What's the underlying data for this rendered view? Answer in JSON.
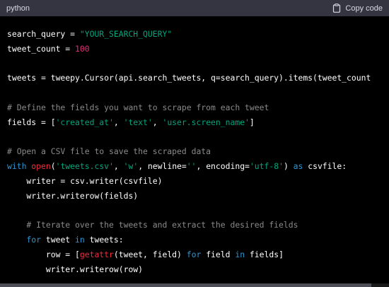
{
  "header": {
    "language": "python",
    "copy_label": "Copy code",
    "copy_icon": "clipboard-icon",
    "background": "#343541"
  },
  "colors": {
    "string": "#00a67d",
    "number": "#df3079",
    "comment": "#8a8a8a",
    "keyword": "#2e95d3",
    "builtin_function": "#f22c3d",
    "plain": "#ffffff"
  },
  "code": {
    "lines": [
      [
        {
          "t": "plain",
          "v": "search_query = "
        },
        {
          "t": "str",
          "v": "\"YOUR_SEARCH_QUERY\""
        }
      ],
      [
        {
          "t": "plain",
          "v": "tweet_count = "
        },
        {
          "t": "num",
          "v": "100"
        }
      ],
      [],
      [
        {
          "t": "plain",
          "v": "tweets = tweepy.Cursor(api.search_tweets, q=search_query).items(tweet_count"
        }
      ],
      [],
      [
        {
          "t": "cmt",
          "v": "# Define the fields you want to scrape from each tweet"
        }
      ],
      [
        {
          "t": "plain",
          "v": "fields = ["
        },
        {
          "t": "str",
          "v": "'created_at'"
        },
        {
          "t": "plain",
          "v": ", "
        },
        {
          "t": "str",
          "v": "'text'"
        },
        {
          "t": "plain",
          "v": ", "
        },
        {
          "t": "str",
          "v": "'user.screen_name'"
        },
        {
          "t": "plain",
          "v": "]"
        }
      ],
      [],
      [
        {
          "t": "cmt",
          "v": "# Open a CSV file to save the scraped data"
        }
      ],
      [
        {
          "t": "kw",
          "v": "with "
        },
        {
          "t": "fn",
          "v": "open"
        },
        {
          "t": "plain",
          "v": "("
        },
        {
          "t": "str",
          "v": "'tweets.csv'"
        },
        {
          "t": "plain",
          "v": ", "
        },
        {
          "t": "str",
          "v": "'w'"
        },
        {
          "t": "plain",
          "v": ", newline="
        },
        {
          "t": "str",
          "v": "''"
        },
        {
          "t": "plain",
          "v": ", encoding="
        },
        {
          "t": "str",
          "v": "'utf-8'"
        },
        {
          "t": "plain",
          "v": ") "
        },
        {
          "t": "kw",
          "v": "as"
        },
        {
          "t": "plain",
          "v": " csvfile:"
        }
      ],
      [
        {
          "t": "plain",
          "v": "    writer = csv.writer(csvfile)"
        }
      ],
      [
        {
          "t": "plain",
          "v": "    writer.writerow(fields)"
        }
      ],
      [],
      [
        {
          "t": "cmt",
          "v": "    # Iterate over the tweets and extract the desired fields"
        }
      ],
      [
        {
          "t": "kw",
          "v": "    for"
        },
        {
          "t": "plain",
          "v": " tweet "
        },
        {
          "t": "kw",
          "v": "in"
        },
        {
          "t": "plain",
          "v": " tweets:"
        }
      ],
      [
        {
          "t": "plain",
          "v": "        row = ["
        },
        {
          "t": "fn",
          "v": "getattr"
        },
        {
          "t": "plain",
          "v": "(tweet, field) "
        },
        {
          "t": "kw",
          "v": "for"
        },
        {
          "t": "plain",
          "v": " field "
        },
        {
          "t": "kw",
          "v": "in"
        },
        {
          "t": "plain",
          "v": " fields]"
        }
      ],
      [
        {
          "t": "plain",
          "v": "        writer.writerow(row)"
        }
      ]
    ]
  }
}
